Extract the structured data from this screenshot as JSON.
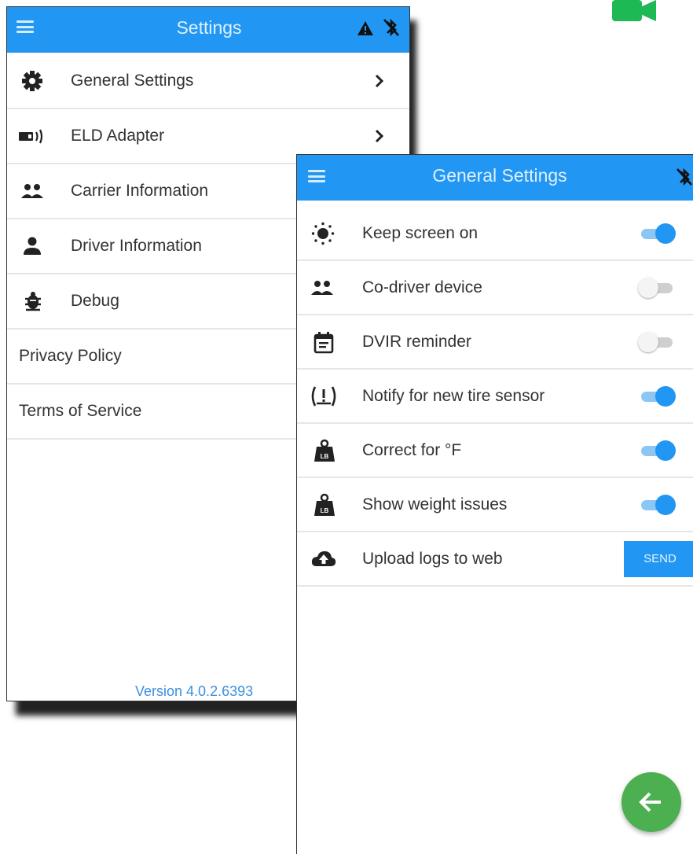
{
  "colors": {
    "primary": "#2196f3",
    "fab": "#4caf50",
    "video": "#1db954"
  },
  "settings": {
    "title": "Settings",
    "items": [
      {
        "label": "General Settings",
        "icon": "gear-icon",
        "chevron": true
      },
      {
        "label": "ELD Adapter",
        "icon": "adapter-icon",
        "chevron": true
      },
      {
        "label": "Carrier Information",
        "icon": "group-icon",
        "chevron": false
      },
      {
        "label": "Driver Information",
        "icon": "person-icon",
        "chevron": false
      },
      {
        "label": "Debug",
        "icon": "bug-icon",
        "chevron": false
      },
      {
        "label": "Privacy Policy"
      },
      {
        "label": "Terms of Service"
      }
    ],
    "version": "Version 4.0.2.6393"
  },
  "general": {
    "title": "General Settings",
    "items": [
      {
        "label": "Keep screen on",
        "icon": "brightness-icon",
        "toggle": true
      },
      {
        "label": "Co-driver device",
        "icon": "group-icon",
        "toggle": false
      },
      {
        "label": "DVIR reminder",
        "icon": "calendar-icon",
        "toggle": false
      },
      {
        "label": "Notify for new tire sensor",
        "icon": "tire-alert-icon",
        "toggle": true
      },
      {
        "label": "Correct for °F",
        "icon": "weight-icon",
        "toggle": true
      },
      {
        "label": "Show weight issues",
        "icon": "weight-icon",
        "toggle": true
      },
      {
        "label": "Upload logs to web",
        "icon": "cloud-upload-icon",
        "button": "SEND"
      }
    ]
  }
}
